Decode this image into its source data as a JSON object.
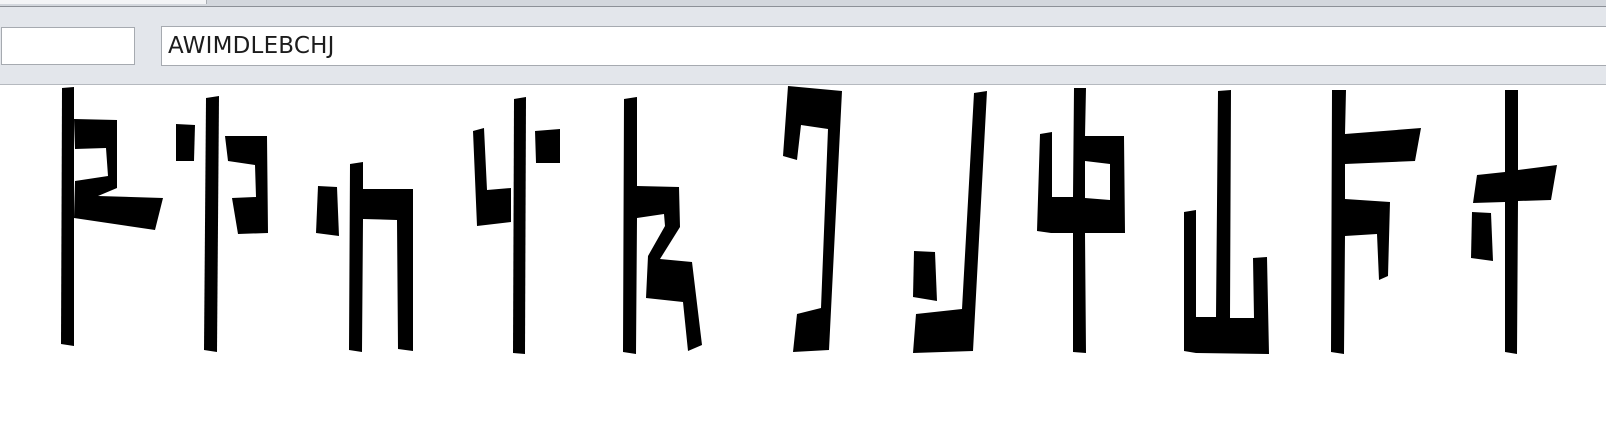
{
  "toolbar": {
    "secondary_input_value": "",
    "main_input_value": "AWIMDLEBCHJ"
  },
  "canvas": {
    "glyph_names": [
      "glyph-1-icon",
      "glyph-2-icon",
      "glyph-3-icon",
      "glyph-4-icon",
      "glyph-5-icon",
      "glyph-6-icon",
      "glyph-7-icon",
      "glyph-8-icon",
      "glyph-9-icon",
      "glyph-10-icon",
      "glyph-11-icon"
    ],
    "fill_color": "#000000"
  }
}
